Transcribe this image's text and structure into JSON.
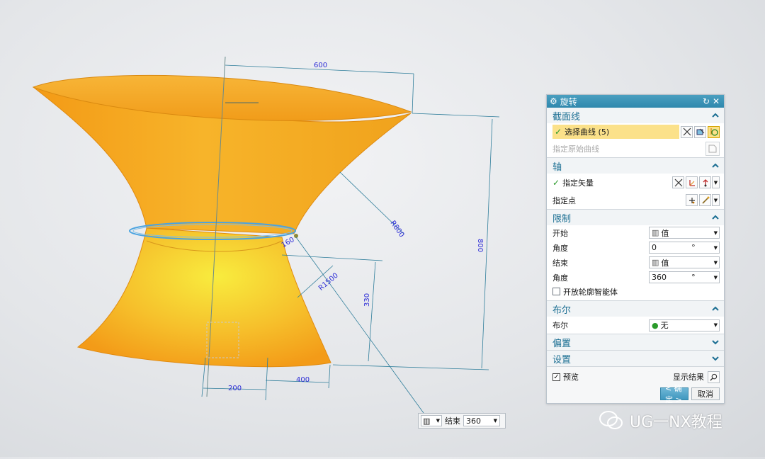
{
  "viewport": {
    "dimensions": {
      "top_width": "600",
      "height": "800",
      "upper_radius": "R800",
      "lower_radius": "R1500",
      "neck": "160",
      "lower_height": "330",
      "bottom_half": "200",
      "bottom_width": "400"
    },
    "colors": {
      "body": "#f5a623",
      "body_light": "#f7e33c",
      "dim_line": "#2e7d9a",
      "dim_text": "#2b2bd6",
      "neck_ring": "#4aa3e0"
    }
  },
  "dialog": {
    "title": "旋转",
    "sections": {
      "section_curve": {
        "label": "截面线",
        "select_curve": "选择曲线 (5)",
        "specify_origin_curve": "指定原始曲线"
      },
      "axis": {
        "label": "轴",
        "specify_vector": "指定矢量",
        "specify_point": "指定点"
      },
      "limits": {
        "label": "限制",
        "start_label": "开始",
        "start_mode": "值",
        "start_angle_label": "角度",
        "start_angle": "0",
        "end_label": "结束",
        "end_mode": "值",
        "end_angle_label": "角度",
        "end_angle": "360",
        "angle_unit": "°",
        "open_profile_label": "开放轮廓智能体"
      },
      "boolean": {
        "label": "布尔",
        "row_label": "布尔",
        "value": "无"
      },
      "offset": {
        "label": "偏置"
      },
      "settings": {
        "label": "设置"
      }
    },
    "preview_label": "预览",
    "show_result_label": "显示结果",
    "ok_label": "< 确定 >",
    "cancel_label": "取消"
  },
  "float_input": {
    "label": "结束",
    "value": "360"
  },
  "watermark": {
    "text": "UG一NX教程"
  }
}
